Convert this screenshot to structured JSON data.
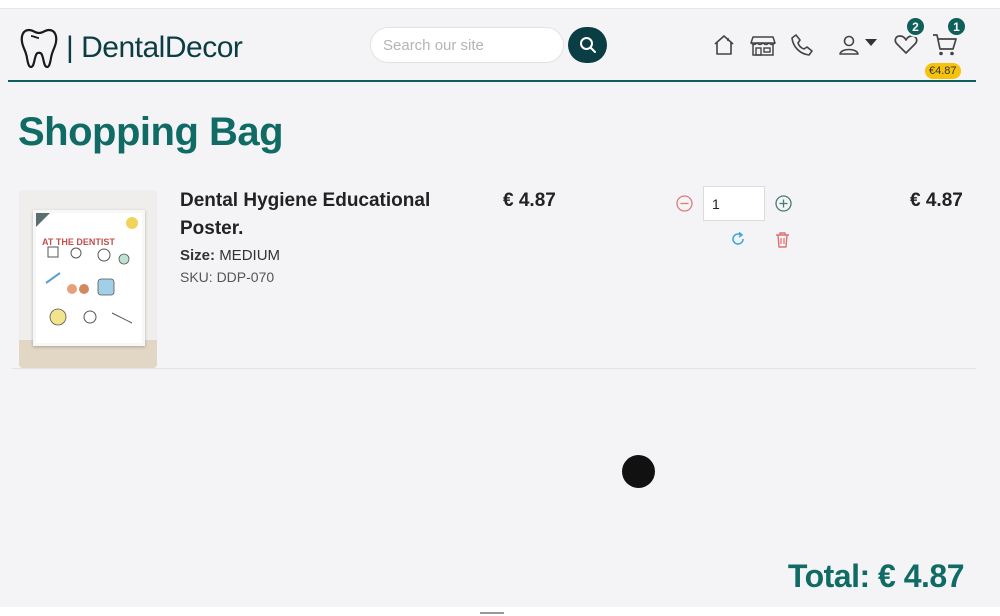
{
  "header": {
    "brand": "| DentalDecor",
    "search_placeholder": "Search our site",
    "wishlist_count": "2",
    "cart_count": "1",
    "cart_total": "€4.87"
  },
  "page": {
    "title": "Shopping Bag"
  },
  "cart": {
    "item": {
      "name": "Dental Hygiene Educational Poster.",
      "size_label": "Size:",
      "size_value": "MEDIUM",
      "sku": "SKU: DDP-070",
      "unit_price": "€ 4.87",
      "quantity": "1",
      "line_price": "€ 4.87",
      "poster_text": "AT THE DENTIST"
    },
    "total": "Total: € 4.87"
  },
  "colors": {
    "brand_teal": "#0f6b64",
    "dark_teal": "#0b3e44",
    "badge_yellow": "#f6c20b"
  },
  "icons": [
    "tooth-logo-icon",
    "search-icon",
    "home-icon",
    "store-icon",
    "phone-icon",
    "user-icon",
    "chevron-down-icon",
    "heart-icon",
    "cart-icon",
    "minus-circle-icon",
    "plus-circle-icon",
    "refresh-icon",
    "trash-icon"
  ]
}
